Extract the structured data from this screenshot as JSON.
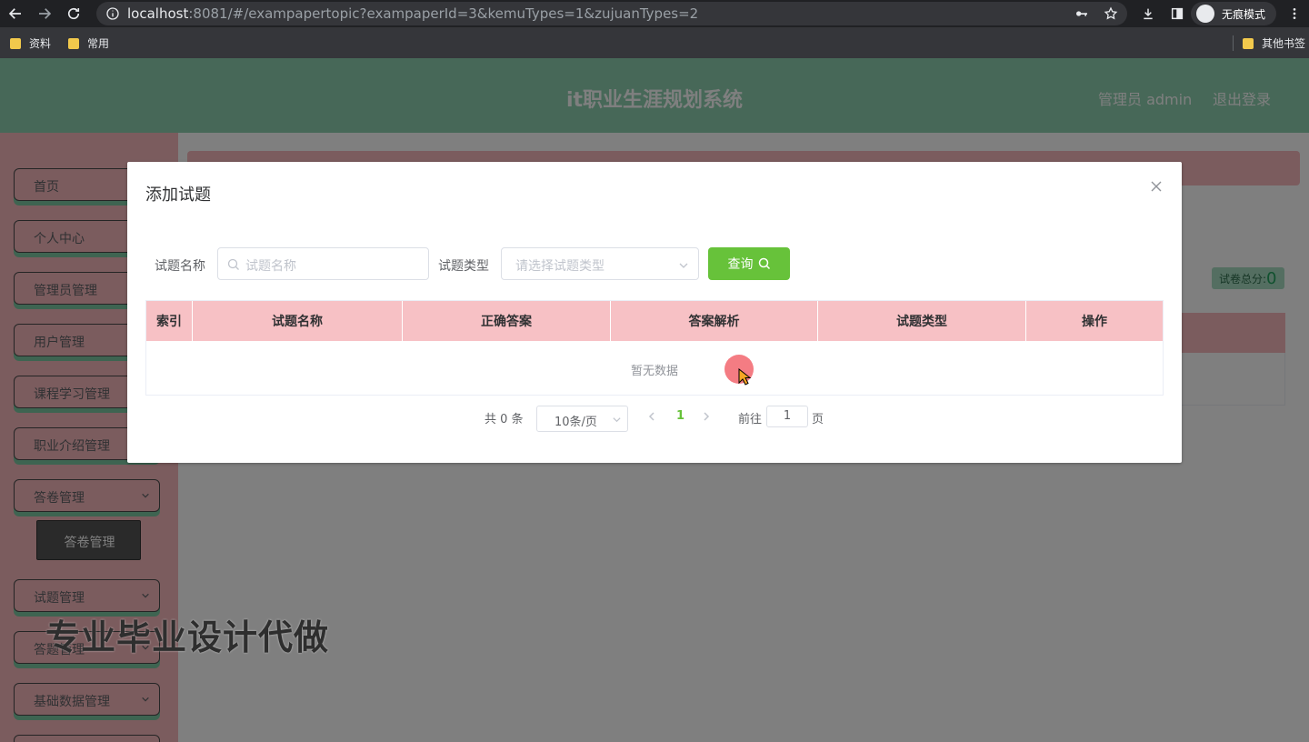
{
  "browser": {
    "url_host": "localhost",
    "url_rest": ":8081/#/exampapertopic?exampaperId=3&kemuTypes=1&zujuanTypes=2",
    "incognito_label": "无痕模式",
    "bookmarks": [
      "资料",
      "常用"
    ],
    "other_bookmarks": "其他书签"
  },
  "header": {
    "title": "it职业生涯规划系统",
    "user": "管理员 admin",
    "logout": "退出登录"
  },
  "sidebar": {
    "items": [
      "首页",
      "个人中心",
      "管理员管理",
      "用户管理",
      "课程学习管理",
      "职业介绍管理",
      "答卷管理",
      "试题管理",
      "答题管理",
      "基础数据管理"
    ],
    "submenu": "答卷管理"
  },
  "content": {
    "total_label": "试卷总分:",
    "total_value": "0"
  },
  "dialog": {
    "title": "添加试题",
    "name_label": "试题名称",
    "name_placeholder": "试题名称",
    "type_label": "试题类型",
    "type_placeholder": "请选择试题类型",
    "query_label": "查询",
    "columns": [
      "索引",
      "试题名称",
      "正确答案",
      "答案解析",
      "试题类型",
      "操作"
    ],
    "empty_text": "暂无数据",
    "pager": {
      "total": "共 0 条",
      "size": "10条/页",
      "page": "1",
      "goto": "前往",
      "goto_value": "1",
      "unit": "页"
    }
  },
  "watermark": "专业毕业设计代做"
}
